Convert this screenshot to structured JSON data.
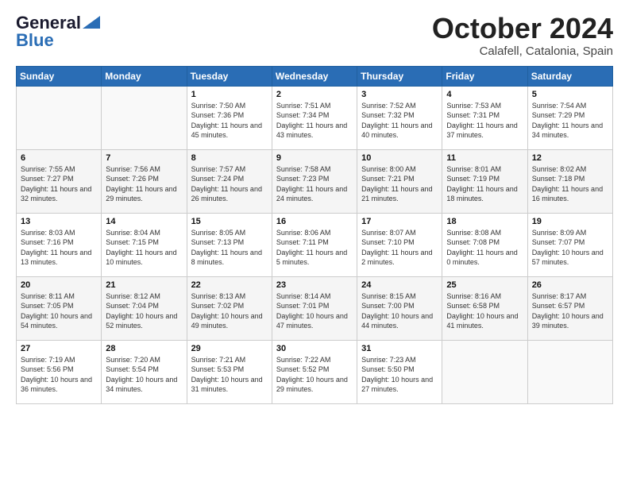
{
  "header": {
    "logo_line1": "General",
    "logo_line2": "Blue",
    "month": "October 2024",
    "location": "Calafell, Catalonia, Spain"
  },
  "weekdays": [
    "Sunday",
    "Monday",
    "Tuesday",
    "Wednesday",
    "Thursday",
    "Friday",
    "Saturday"
  ],
  "weeks": [
    [
      {
        "day": "",
        "info": ""
      },
      {
        "day": "",
        "info": ""
      },
      {
        "day": "1",
        "info": "Sunrise: 7:50 AM\nSunset: 7:36 PM\nDaylight: 11 hours and 45 minutes."
      },
      {
        "day": "2",
        "info": "Sunrise: 7:51 AM\nSunset: 7:34 PM\nDaylight: 11 hours and 43 minutes."
      },
      {
        "day": "3",
        "info": "Sunrise: 7:52 AM\nSunset: 7:32 PM\nDaylight: 11 hours and 40 minutes."
      },
      {
        "day": "4",
        "info": "Sunrise: 7:53 AM\nSunset: 7:31 PM\nDaylight: 11 hours and 37 minutes."
      },
      {
        "day": "5",
        "info": "Sunrise: 7:54 AM\nSunset: 7:29 PM\nDaylight: 11 hours and 34 minutes."
      }
    ],
    [
      {
        "day": "6",
        "info": "Sunrise: 7:55 AM\nSunset: 7:27 PM\nDaylight: 11 hours and 32 minutes."
      },
      {
        "day": "7",
        "info": "Sunrise: 7:56 AM\nSunset: 7:26 PM\nDaylight: 11 hours and 29 minutes."
      },
      {
        "day": "8",
        "info": "Sunrise: 7:57 AM\nSunset: 7:24 PM\nDaylight: 11 hours and 26 minutes."
      },
      {
        "day": "9",
        "info": "Sunrise: 7:58 AM\nSunset: 7:23 PM\nDaylight: 11 hours and 24 minutes."
      },
      {
        "day": "10",
        "info": "Sunrise: 8:00 AM\nSunset: 7:21 PM\nDaylight: 11 hours and 21 minutes."
      },
      {
        "day": "11",
        "info": "Sunrise: 8:01 AM\nSunset: 7:19 PM\nDaylight: 11 hours and 18 minutes."
      },
      {
        "day": "12",
        "info": "Sunrise: 8:02 AM\nSunset: 7:18 PM\nDaylight: 11 hours and 16 minutes."
      }
    ],
    [
      {
        "day": "13",
        "info": "Sunrise: 8:03 AM\nSunset: 7:16 PM\nDaylight: 11 hours and 13 minutes."
      },
      {
        "day": "14",
        "info": "Sunrise: 8:04 AM\nSunset: 7:15 PM\nDaylight: 11 hours and 10 minutes."
      },
      {
        "day": "15",
        "info": "Sunrise: 8:05 AM\nSunset: 7:13 PM\nDaylight: 11 hours and 8 minutes."
      },
      {
        "day": "16",
        "info": "Sunrise: 8:06 AM\nSunset: 7:11 PM\nDaylight: 11 hours and 5 minutes."
      },
      {
        "day": "17",
        "info": "Sunrise: 8:07 AM\nSunset: 7:10 PM\nDaylight: 11 hours and 2 minutes."
      },
      {
        "day": "18",
        "info": "Sunrise: 8:08 AM\nSunset: 7:08 PM\nDaylight: 11 hours and 0 minutes."
      },
      {
        "day": "19",
        "info": "Sunrise: 8:09 AM\nSunset: 7:07 PM\nDaylight: 10 hours and 57 minutes."
      }
    ],
    [
      {
        "day": "20",
        "info": "Sunrise: 8:11 AM\nSunset: 7:05 PM\nDaylight: 10 hours and 54 minutes."
      },
      {
        "day": "21",
        "info": "Sunrise: 8:12 AM\nSunset: 7:04 PM\nDaylight: 10 hours and 52 minutes."
      },
      {
        "day": "22",
        "info": "Sunrise: 8:13 AM\nSunset: 7:02 PM\nDaylight: 10 hours and 49 minutes."
      },
      {
        "day": "23",
        "info": "Sunrise: 8:14 AM\nSunset: 7:01 PM\nDaylight: 10 hours and 47 minutes."
      },
      {
        "day": "24",
        "info": "Sunrise: 8:15 AM\nSunset: 7:00 PM\nDaylight: 10 hours and 44 minutes."
      },
      {
        "day": "25",
        "info": "Sunrise: 8:16 AM\nSunset: 6:58 PM\nDaylight: 10 hours and 41 minutes."
      },
      {
        "day": "26",
        "info": "Sunrise: 8:17 AM\nSunset: 6:57 PM\nDaylight: 10 hours and 39 minutes."
      }
    ],
    [
      {
        "day": "27",
        "info": "Sunrise: 7:19 AM\nSunset: 5:56 PM\nDaylight: 10 hours and 36 minutes."
      },
      {
        "day": "28",
        "info": "Sunrise: 7:20 AM\nSunset: 5:54 PM\nDaylight: 10 hours and 34 minutes."
      },
      {
        "day": "29",
        "info": "Sunrise: 7:21 AM\nSunset: 5:53 PM\nDaylight: 10 hours and 31 minutes."
      },
      {
        "day": "30",
        "info": "Sunrise: 7:22 AM\nSunset: 5:52 PM\nDaylight: 10 hours and 29 minutes."
      },
      {
        "day": "31",
        "info": "Sunrise: 7:23 AM\nSunset: 5:50 PM\nDaylight: 10 hours and 27 minutes."
      },
      {
        "day": "",
        "info": ""
      },
      {
        "day": "",
        "info": ""
      }
    ]
  ]
}
